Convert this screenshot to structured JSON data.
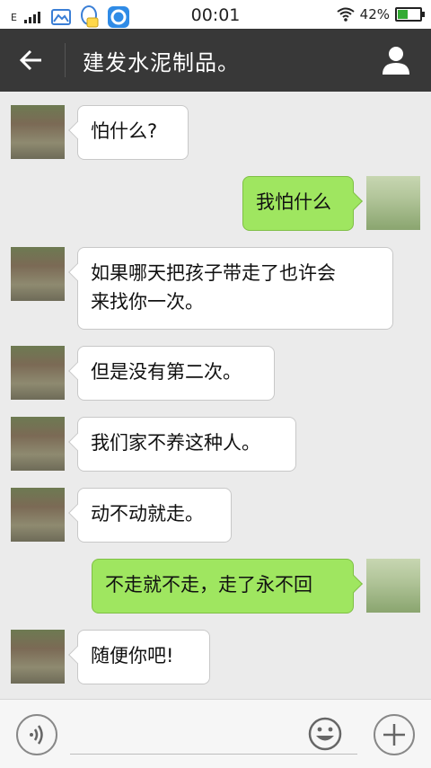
{
  "status_bar": {
    "network_label": "E",
    "time": "00:01",
    "battery_percent": "42%",
    "battery_level": 0.42
  },
  "header": {
    "title": "建发水泥制品。"
  },
  "messages": [
    {
      "side": "in",
      "text": "怕什么?"
    },
    {
      "side": "out",
      "text": "我怕什么"
    },
    {
      "side": "in",
      "text": "如果哪天把孩子带走了也许会\n来找你一次。"
    },
    {
      "side": "in",
      "text": "但是没有第二次。"
    },
    {
      "side": "in",
      "text": "我们家不养这种人。"
    },
    {
      "side": "in",
      "text": "动不动就走。"
    },
    {
      "side": "out",
      "text": "不走就不走，走了永不回"
    },
    {
      "side": "in",
      "text": "随便你吧!"
    }
  ],
  "colors": {
    "header_bg": "#383838",
    "chat_bg": "#ebebeb",
    "outgoing_bubble": "#9fe660",
    "incoming_bubble": "#ffffff"
  },
  "icons": {
    "back": "arrow-left-icon",
    "profile": "person-icon",
    "voice": "voice-icon",
    "emoji": "smiley-icon",
    "more": "plus-icon"
  }
}
